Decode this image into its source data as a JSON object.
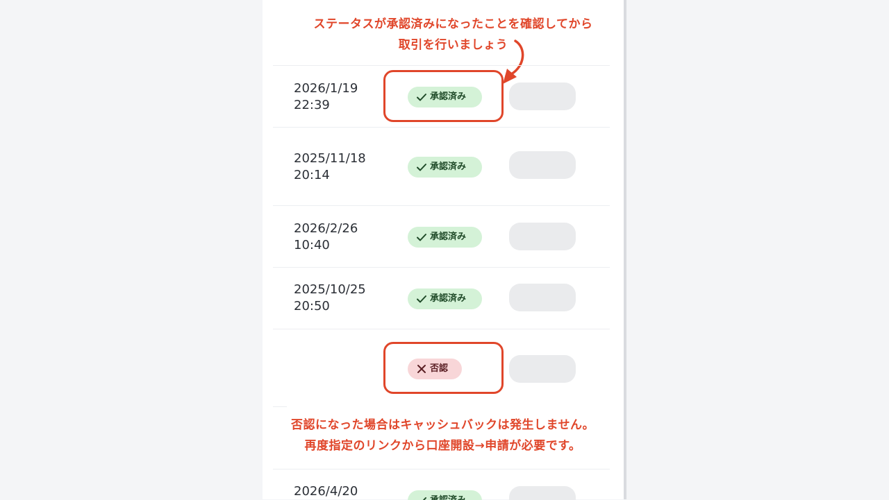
{
  "annotations": {
    "top_line1": "ステータスが承認済みになったことを確認してから",
    "top_line2": "取引を行いましょう",
    "bottom_line1": "否認になった場合はキャッシュバックは発生しません。",
    "bottom_line2": "再度指定のリンクから口座開設→申請が必要です。"
  },
  "rows": [
    {
      "date": "2026/1/19",
      "time": "22:39",
      "status": "承認済み",
      "status_type": "approved"
    },
    {
      "date": "2025/11/18",
      "time": "20:14",
      "status": "承認済み",
      "status_type": "approved"
    },
    {
      "date": "2026/2/26",
      "time": "10:40",
      "status": "承認済み",
      "status_type": "approved"
    },
    {
      "date": "2025/10/25",
      "time": "20:50",
      "status": "承認済み",
      "status_type": "approved"
    },
    {
      "date": "",
      "time": "",
      "status": "否認",
      "status_type": "rejected"
    },
    {
      "date": "2026/4/20",
      "time": "",
      "status": "承認済み",
      "status_type": "approved"
    }
  ],
  "colors": {
    "annotation": "#e0462a",
    "approved_bg": "#d4f2d7",
    "rejected_bg": "#f8d6d8"
  },
  "icons": {
    "approved": "check-icon",
    "rejected": "x-icon"
  }
}
